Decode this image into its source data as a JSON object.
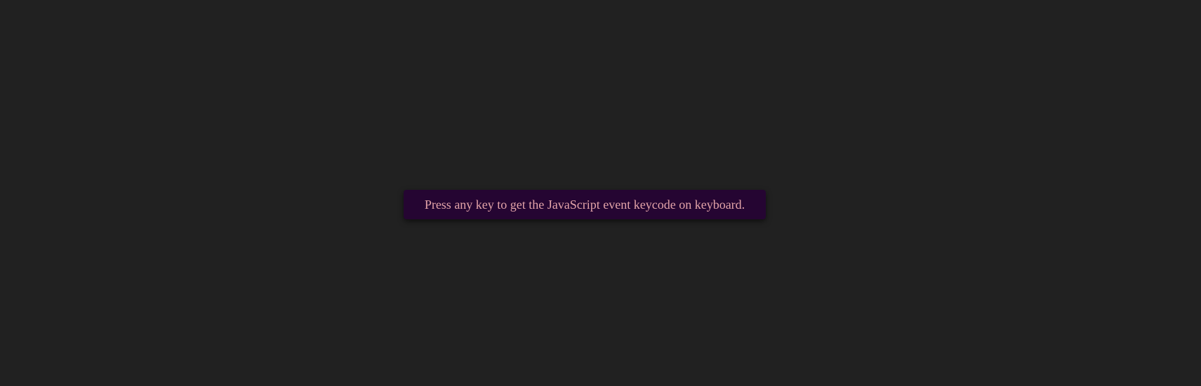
{
  "message": {
    "text": "Press any key to get the JavaScript event keycode on keyboard."
  },
  "colors": {
    "page_background": "#212121",
    "box_background": "#250532",
    "text": "#e3a4a9"
  }
}
